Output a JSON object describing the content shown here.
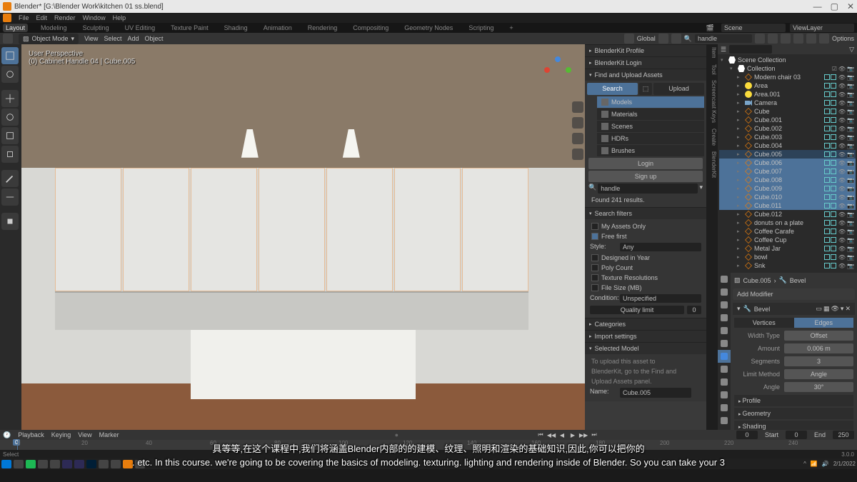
{
  "window": {
    "title": "Blender* [G:\\Blender Work\\kitchen 01 ss.blend]",
    "min": "—",
    "max": "▢",
    "close": "✕"
  },
  "menu": {
    "file": "File",
    "edit": "Edit",
    "render": "Render",
    "window": "Window",
    "help": "Help"
  },
  "workspaces": {
    "layout": "Layout",
    "modeling": "Modeling",
    "sculpting": "Sculpting",
    "uv": "UV Editing",
    "texpaint": "Texture Paint",
    "shading": "Shading",
    "animation": "Animation",
    "rendering": "Rendering",
    "compositing": "Compositing",
    "geonodes": "Geometry Nodes",
    "scripting": "Scripting",
    "add": "+",
    "scene": "Scene",
    "viewlayer": "ViewLayer"
  },
  "tool_header": {
    "mode": "Object Mode",
    "view": "View",
    "select": "Select",
    "add": "Add",
    "object": "Object",
    "orientation": "Global",
    "search_value": "handle",
    "options": "Options"
  },
  "viewport": {
    "perspective": "User Perspective",
    "object_info": "(0) Cabinet Handle 04 | Cube.005"
  },
  "blenderkit": {
    "profile": "BlenderKit Profile",
    "login_panel": "BlenderKit Login",
    "find_upload": "Find and Upload Assets",
    "search_tab": "Search",
    "upload_tab": "Upload",
    "types": {
      "models": "Models",
      "materials": "Materials",
      "scenes": "Scenes",
      "hdrs": "HDRs",
      "brushes": "Brushes"
    },
    "login_btn": "Login",
    "signup_btn": "Sign up",
    "search_value": "handle",
    "results": "Found 241 results.",
    "search_filters": "Search filters",
    "my_assets": "My Assets Only",
    "free_first": "Free first",
    "style_label": "Style:",
    "style_value": "Any",
    "designed_year": "Designed in Year",
    "poly_count": "Poly Count",
    "tex_res": "Texture Resolutions",
    "file_size": "File Size (MB)",
    "condition_label": "Condition:",
    "condition_value": "Unspecified",
    "quality_limit": "Quality limit",
    "quality_value": "0",
    "categories": "Categories",
    "import_settings": "Import settings",
    "selected_model": "Selected Model",
    "upload_hint1": "To upload this asset to",
    "upload_hint2": "BlenderKit, go to the Find and",
    "upload_hint3": "Upload Assets panel.",
    "name_label": "Name:",
    "name_value": "Cube.005"
  },
  "right_tabs": {
    "item": "Item",
    "tool": "Tool",
    "keys": "Screencast Keys",
    "create": "Create",
    "bk": "BlenderKit"
  },
  "outliner": {
    "scene_collection": "Scene Collection",
    "collection": "Collection",
    "items": [
      {
        "name": "Modern chair 03",
        "type": "mesh",
        "indent": 2
      },
      {
        "name": "Area",
        "type": "light",
        "indent": 2
      },
      {
        "name": "Area.001",
        "type": "light",
        "indent": 2
      },
      {
        "name": "Camera",
        "type": "camera",
        "indent": 2
      },
      {
        "name": "Cube",
        "type": "mesh",
        "indent": 2
      },
      {
        "name": "Cube.001",
        "type": "mesh",
        "indent": 2
      },
      {
        "name": "Cube.002",
        "type": "mesh",
        "indent": 2
      },
      {
        "name": "Cube.003",
        "type": "mesh",
        "indent": 2
      },
      {
        "name": "Cube.004",
        "type": "mesh",
        "indent": 2
      },
      {
        "name": "Cube.005",
        "type": "mesh",
        "indent": 2,
        "active": true
      },
      {
        "name": "Cube.006",
        "type": "mesh",
        "indent": 2,
        "selected": true
      },
      {
        "name": "Cube.007",
        "type": "mesh",
        "indent": 2,
        "selected": true
      },
      {
        "name": "Cube.008",
        "type": "mesh",
        "indent": 2,
        "selected": true
      },
      {
        "name": "Cube.009",
        "type": "mesh",
        "indent": 2,
        "selected": true
      },
      {
        "name": "Cube.010",
        "type": "mesh",
        "indent": 2,
        "selected": true
      },
      {
        "name": "Cube.011",
        "type": "mesh",
        "indent": 2,
        "selected": true
      },
      {
        "name": "Cube.012",
        "type": "mesh",
        "indent": 2
      },
      {
        "name": "donuts on a plate",
        "type": "mesh",
        "indent": 2
      },
      {
        "name": "Coffee Carafe",
        "type": "mesh",
        "indent": 2
      },
      {
        "name": "Coffee Cup",
        "type": "mesh",
        "indent": 2
      },
      {
        "name": "Metal Jar",
        "type": "mesh",
        "indent": 2
      },
      {
        "name": "bowl",
        "type": "mesh",
        "indent": 2
      },
      {
        "name": "Snk",
        "type": "mesh",
        "indent": 2
      }
    ]
  },
  "properties": {
    "breadcrumb_obj": "Cube.005",
    "breadcrumb_mod": "Bevel",
    "add_modifier": "Add Modifier",
    "mod_name": "Bevel",
    "vertices": "Vertices",
    "edges": "Edges",
    "width_type_label": "Width Type",
    "width_type_value": "Offset",
    "amount_label": "Amount",
    "amount_value": "0.006 m",
    "segments_label": "Segments",
    "segments_value": "3",
    "limit_method_label": "Limit Method",
    "limit_method_value": "Angle",
    "angle_label": "Angle",
    "angle_value": "30°",
    "profile": "Profile",
    "geometry": "Geometry",
    "shading": "Shading"
  },
  "timeline": {
    "playback": "Playback",
    "keying": "Keying",
    "view": "View",
    "marker": "Marker",
    "current": "0",
    "start_label": "Start",
    "start": "0",
    "end_label": "End",
    "end": "250",
    "ticks": [
      "0",
      "20",
      "40",
      "60",
      "80",
      "100",
      "120",
      "140",
      "160",
      "180",
      "200",
      "220",
      "240"
    ]
  },
  "subtitles": {
    "cn": "具等等,在这个课程中,我们将涵盖Blender内部的的建模、纹理、照明和渲染的基础知识,因此,你可以把你的",
    "en": ". etc. In this course. we're going to be covering the basics of modeling. texturing. lighting and rendering inside of Blender. So you can take your 3"
  },
  "statusbar": {
    "version": "3.0.0",
    "time": "2/1/2022"
  }
}
